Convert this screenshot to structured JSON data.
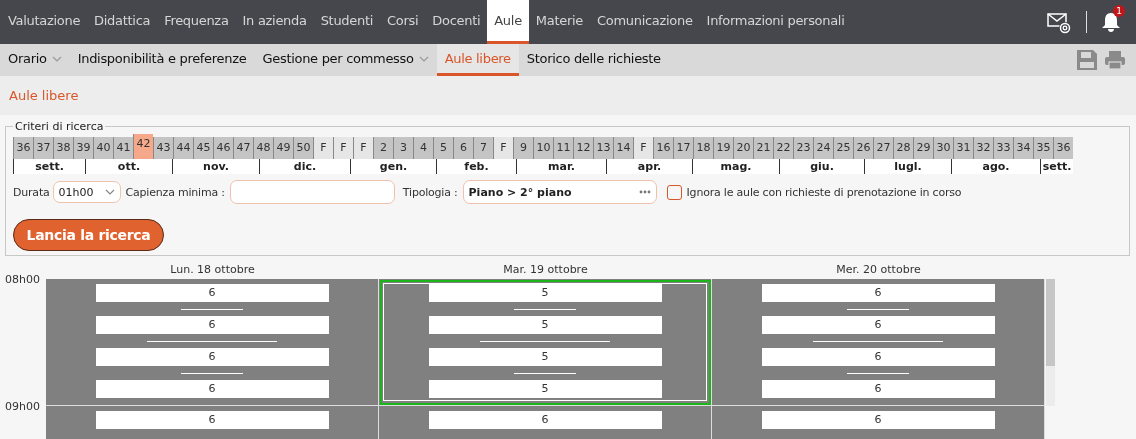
{
  "top_nav": {
    "items": [
      {
        "label": "Valutazione",
        "selected": false
      },
      {
        "label": "Didattica",
        "selected": false
      },
      {
        "label": "Frequenza",
        "selected": false
      },
      {
        "label": "In azienda",
        "selected": false
      },
      {
        "label": "Studenti",
        "selected": false
      },
      {
        "label": "Corsi",
        "selected": false
      },
      {
        "label": "Docenti",
        "selected": false
      },
      {
        "label": "Aule",
        "selected": true
      },
      {
        "label": "Materie",
        "selected": false
      },
      {
        "label": "Comunicazione",
        "selected": false
      },
      {
        "label": "Informazioni personali",
        "selected": false
      }
    ],
    "notification_count": "1"
  },
  "sub_nav": {
    "items": [
      {
        "label": "Orario",
        "selected": false,
        "dropdown": true
      },
      {
        "label": "Indisponibilità e preferenze",
        "selected": false,
        "dropdown": false
      },
      {
        "label": "Gestione per commesso",
        "selected": false,
        "dropdown": true
      },
      {
        "label": "Aule libere",
        "selected": true,
        "dropdown": false
      },
      {
        "label": "Storico delle richieste",
        "selected": false,
        "dropdown": false
      }
    ]
  },
  "page_title": "Aule libere",
  "criteria": {
    "legend": "Criteri di ricerca",
    "weeks": [
      {
        "label": "36",
        "kind": "week",
        "selected": false
      },
      {
        "label": "37",
        "kind": "week",
        "selected": false
      },
      {
        "label": "38",
        "kind": "week",
        "selected": false
      },
      {
        "label": "39",
        "kind": "week",
        "selected": false
      },
      {
        "label": "40",
        "kind": "week",
        "selected": false
      },
      {
        "label": "41",
        "kind": "week",
        "selected": false
      },
      {
        "label": "42",
        "kind": "week",
        "selected": true
      },
      {
        "label": "43",
        "kind": "week",
        "selected": false
      },
      {
        "label": "44",
        "kind": "week",
        "selected": false
      },
      {
        "label": "45",
        "kind": "week",
        "selected": false
      },
      {
        "label": "46",
        "kind": "week",
        "selected": false
      },
      {
        "label": "47",
        "kind": "week",
        "selected": false
      },
      {
        "label": "48",
        "kind": "week",
        "selected": false
      },
      {
        "label": "49",
        "kind": "week",
        "selected": false
      },
      {
        "label": "50",
        "kind": "week",
        "selected": false
      },
      {
        "label": "F",
        "kind": "holiday",
        "selected": false
      },
      {
        "label": "F",
        "kind": "holiday",
        "selected": false
      },
      {
        "label": "F",
        "kind": "holiday",
        "selected": false
      },
      {
        "label": "2",
        "kind": "week",
        "selected": false
      },
      {
        "label": "3",
        "kind": "week",
        "selected": false
      },
      {
        "label": "4",
        "kind": "week",
        "selected": false
      },
      {
        "label": "5",
        "kind": "week",
        "selected": false
      },
      {
        "label": "6",
        "kind": "week",
        "selected": false
      },
      {
        "label": "7",
        "kind": "week",
        "selected": false
      },
      {
        "label": "F",
        "kind": "holiday",
        "selected": false
      },
      {
        "label": "9",
        "kind": "week",
        "selected": false
      },
      {
        "label": "10",
        "kind": "week",
        "selected": false
      },
      {
        "label": "11",
        "kind": "week",
        "selected": false
      },
      {
        "label": "12",
        "kind": "week",
        "selected": false
      },
      {
        "label": "13",
        "kind": "week",
        "selected": false
      },
      {
        "label": "14",
        "kind": "week",
        "selected": false
      },
      {
        "label": "F",
        "kind": "holiday",
        "selected": false
      },
      {
        "label": "16",
        "kind": "week",
        "selected": false
      },
      {
        "label": "17",
        "kind": "week",
        "selected": false
      },
      {
        "label": "18",
        "kind": "week",
        "selected": false
      },
      {
        "label": "19",
        "kind": "week",
        "selected": false
      },
      {
        "label": "20",
        "kind": "week",
        "selected": false
      },
      {
        "label": "21",
        "kind": "week",
        "selected": false
      },
      {
        "label": "22",
        "kind": "week",
        "selected": false
      },
      {
        "label": "23",
        "kind": "week",
        "selected": false
      },
      {
        "label": "24",
        "kind": "week",
        "selected": false
      },
      {
        "label": "25",
        "kind": "week",
        "selected": false
      },
      {
        "label": "26",
        "kind": "week",
        "selected": false
      },
      {
        "label": "27",
        "kind": "week",
        "selected": false
      },
      {
        "label": "28",
        "kind": "week",
        "selected": false
      },
      {
        "label": "29",
        "kind": "week",
        "selected": false
      },
      {
        "label": "30",
        "kind": "week",
        "selected": false
      },
      {
        "label": "31",
        "kind": "week",
        "selected": false
      },
      {
        "label": "32",
        "kind": "week",
        "selected": false
      },
      {
        "label": "33",
        "kind": "week",
        "selected": false
      },
      {
        "label": "34",
        "kind": "week",
        "selected": false
      },
      {
        "label": "35",
        "kind": "week",
        "selected": false
      },
      {
        "label": "36",
        "kind": "week",
        "selected": false
      }
    ],
    "months": [
      "sett.",
      "ott.",
      "nov.",
      "dic.",
      "gen.",
      "feb.",
      "mar.",
      "apr.",
      "mag.",
      "giu.",
      "lugl.",
      "ago.",
      "sett."
    ],
    "duration": {
      "label": "Durata",
      "value": "01h00"
    },
    "capacity": {
      "label": "Capienza minima :"
    },
    "type": {
      "label": "Tipologia :",
      "value": "Piano > 2° piano"
    },
    "ignore_pending": {
      "label": "Ignora le aule con richieste di prenotazione in corso",
      "checked": false
    },
    "search_button": "Lancia la ricerca"
  },
  "grid": {
    "days": [
      "Lun. 18 ottobre",
      "Mar. 19 ottobre",
      "Mer. 20 ottobre"
    ],
    "hours": [
      {
        "time": "08h00",
        "cells": [
          {
            "values": [
              "6",
              "6",
              "6",
              "6"
            ],
            "selected": false
          },
          {
            "values": [
              "5",
              "5",
              "5",
              "5"
            ],
            "selected": true
          },
          {
            "values": [
              "6",
              "6",
              "6",
              "6"
            ],
            "selected": false
          }
        ]
      },
      {
        "time": "09h00",
        "cells": [
          {
            "values": [
              "6"
            ],
            "selected": false
          },
          {
            "values": [
              "6"
            ],
            "selected": false
          },
          {
            "values": [
              "6"
            ],
            "selected": false
          }
        ]
      }
    ]
  }
}
